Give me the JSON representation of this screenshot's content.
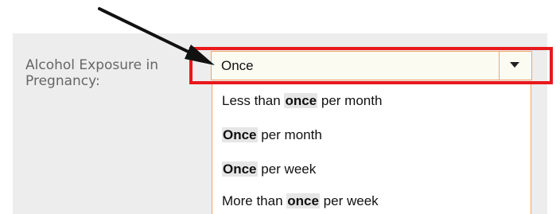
{
  "field": {
    "label": "Alcohol Exposure in\nPregnancy:"
  },
  "select": {
    "value": "Once",
    "arrow_icon": "caret-down-icon"
  },
  "options": [
    {
      "pre": "Less than ",
      "match": "once",
      "post": " per month"
    },
    {
      "pre": "",
      "match": "Once",
      "post": " per month"
    },
    {
      "pre": "",
      "match": "Once",
      "post": " per week"
    },
    {
      "pre": "More than ",
      "match": "once",
      "post": " per week"
    }
  ],
  "annotation": {
    "highlight_color": "#e8181b",
    "arrow_color": "#111111"
  },
  "colors": {
    "panel_bg": "#ededed",
    "select_border": "#f2a36a",
    "select_bg": "#fbfbf2"
  }
}
